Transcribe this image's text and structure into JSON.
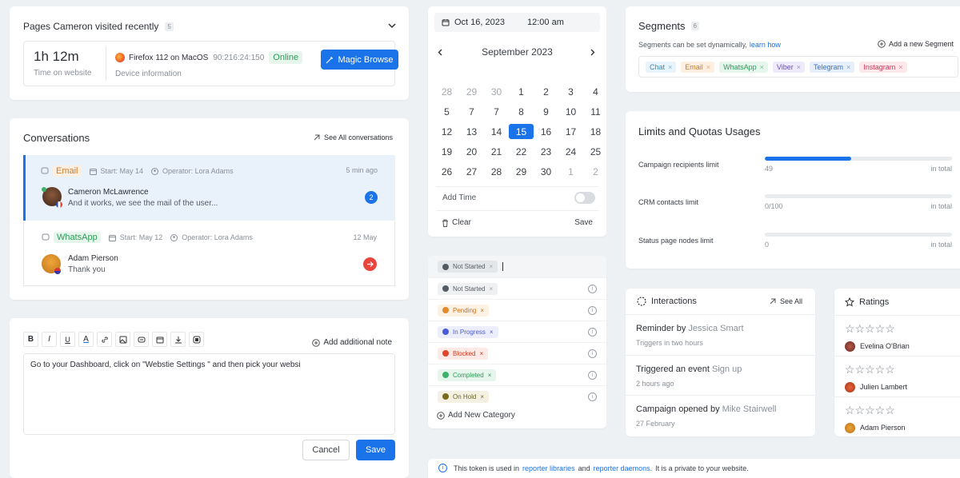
{
  "visits": {
    "title": "Pages Cameron visited recently",
    "count": "5",
    "duration": "1h 12m",
    "duration_label": "Time on website",
    "browser": "Firefox 112 on MacOS",
    "ip": "90:216:24:150",
    "status": "Online",
    "device_label": "Device information",
    "magic_label": "Magic Browse"
  },
  "conversations": {
    "title": "Conversations",
    "see_all": "See All conversations",
    "items": [
      {
        "channel": "Email",
        "start": "Start: May 14",
        "operator": "Operator: Lora Adams",
        "time": "5 min ago",
        "name": "Cameron McLawrence",
        "message": "And it works, we see the mail of the user...",
        "badge": "2"
      },
      {
        "channel": "WhatsApp",
        "start": "Start: May 12",
        "operator": "Operator: Lora Adams",
        "time": "12 May",
        "name": "Adam Pierson",
        "message": "Thank you"
      }
    ]
  },
  "note": {
    "add_note": "Add additional note",
    "text": "Go to your Dashboard, click on \"Webstie Settings \" and then pick your websi",
    "cancel": "Cancel",
    "save": "Save",
    "toolbar": [
      "B",
      "I",
      "U",
      "A"
    ]
  },
  "calendar": {
    "date": "Oct 16, 2023",
    "time": "12:00 am",
    "month": "September 2023",
    "weeks": [
      [
        "28",
        "29",
        "30",
        "1",
        "2",
        "3",
        "4"
      ],
      [
        "5",
        "7",
        "7",
        "8",
        "9",
        "10",
        "11"
      ],
      [
        "12",
        "13",
        "14",
        "15",
        "16",
        "17",
        "18"
      ],
      [
        "19",
        "20",
        "21",
        "22",
        "23",
        "24",
        "25"
      ],
      [
        "26",
        "27",
        "28",
        "29",
        "30",
        "1",
        "2"
      ]
    ],
    "add_time": "Add Time",
    "clear": "Clear",
    "save": "Save"
  },
  "statuses": {
    "first": "Not Started",
    "items": [
      {
        "label": "Not Started",
        "color": "#555b62",
        "bg": "#eef0f2",
        "fg": "#555b62"
      },
      {
        "label": "Pending",
        "color": "#e08a2c",
        "bg": "#fdf1e4",
        "fg": "#c8721a"
      },
      {
        "label": "In Progress",
        "color": "#4a5bd8",
        "bg": "#eceefc",
        "fg": "#4a5bd8"
      },
      {
        "label": "Blocked",
        "color": "#e0432a",
        "bg": "#fde9e5",
        "fg": "#cf3a22"
      },
      {
        "label": "Completed",
        "color": "#3bb26a",
        "bg": "#e6f6ec",
        "fg": "#2e9a58"
      },
      {
        "label": "On Hold",
        "color": "#7a6a1c",
        "bg": "#f4f1e2",
        "fg": "#6f6218"
      }
    ],
    "add_category": "Add New Category"
  },
  "segments": {
    "title": "Segments",
    "count": "6",
    "desc": "Segments can be set dynamically,",
    "learn": "learn how",
    "add": "Add a new Segment",
    "chips": [
      {
        "label": "Chat",
        "bg": "#e7f4fb",
        "fg": "#3a89b5"
      },
      {
        "label": "Email",
        "bg": "#fdf0e2",
        "fg": "#d27a25"
      },
      {
        "label": "WhatsApp",
        "bg": "#e6f6ec",
        "fg": "#2e9a58"
      },
      {
        "label": "Viber",
        "bg": "#eeeaf9",
        "fg": "#6a4fc5"
      },
      {
        "label": "Telegram",
        "bg": "#e7effb",
        "fg": "#3a6fc0"
      },
      {
        "label": "Instagram",
        "bg": "#fde8ec",
        "fg": "#cc3a5a"
      }
    ]
  },
  "limits": {
    "title": "Limits and Quotas Usages",
    "items": [
      {
        "label": "Campaign recipients limit",
        "value": "49",
        "total": "in total",
        "fill": 0.46
      },
      {
        "label": "CRM contacts limit",
        "value": "0/100",
        "total": "in total",
        "fill": 0
      },
      {
        "label": "Status page nodes limit",
        "value": "0",
        "total": "in total",
        "fill": 0
      }
    ]
  },
  "interactions": {
    "title": "Interactions",
    "see_all": "See All",
    "items": [
      {
        "action": "Reminder by",
        "who": "Jessica Smart",
        "sub": "Triggers in two hours"
      },
      {
        "action": "Triggered an event",
        "who": "Sign up",
        "sub": "2 hours ago"
      },
      {
        "action": "Campaign opened by",
        "who": "Mike Stairwell",
        "sub": "27 February"
      }
    ]
  },
  "ratings": {
    "title": "Ratings",
    "items": [
      {
        "name": "Evelina O'Brian",
        "stars": 0
      },
      {
        "name": "Julien Lambert",
        "stars": 0
      },
      {
        "name": "Adam Pierson",
        "stars": 0
      }
    ]
  },
  "token": {
    "pre": "This token is used in",
    "link1": "reporter libraries",
    "mid": "and",
    "link2": "reporter daemons.",
    "post": "It is a private to your website."
  },
  "colors": {
    "accent": "#1a73e8",
    "online": "#2e9a58",
    "danger": "#e8453c"
  }
}
